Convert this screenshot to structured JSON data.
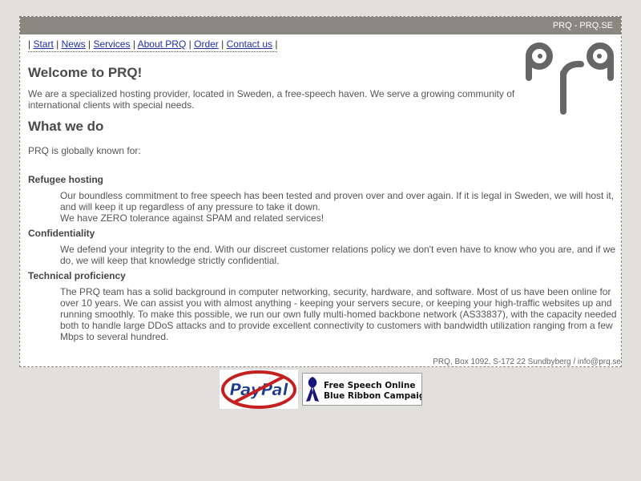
{
  "header": {
    "brand": "PRQ - PRQ.SE"
  },
  "nav": {
    "items": [
      "Start",
      "News",
      "Services",
      "About PRQ",
      "Order",
      "Contact us"
    ],
    "separator": "|"
  },
  "logo": {
    "text": "prq",
    "color": "#666666"
  },
  "main": {
    "welcome_title": "Welcome to PRQ!",
    "welcome_text": "We are a specialized hosting provider, located in Sweden, a free-speech haven. We serve a growing community of international clients with special needs.",
    "what_title": "What we do",
    "known_for": "PRQ is globally known for:",
    "sections": [
      {
        "term": "Refugee hosting",
        "desc1": "Our boundless commitment to free speech has been tested and proven over and over again. If it is legal in Sweden, we will host it, and will keep it up regardless of any pressure to take it down.",
        "desc2": "We have ZERO tolerance against SPAM and related services!"
      },
      {
        "term": "Confidentiality",
        "desc1": "We defend your integrity to the end. With our discreet customer relations policy we don't even have to know who you are, and if we do, we will keep that knowledge strictly confidential."
      },
      {
        "term": "Technical proficiency",
        "desc1": "The PRQ team has a solid background in computer networking, security, hardware, and software. Most of us have been online for over 10 years. We can assist you with almost anything - keeping your servers secure, or keeping your high-traffic websites up and running smoothly. To make this possible, we run our own fully multi-homed backbone network (AS33837), with the capacity needed both to handle large DDoS attacks and to provide excellent connectivity to customers with bandwidth utilization ranging from a few Mbps to several hundred."
      }
    ]
  },
  "footer": {
    "address": "PRQ, Box 1092, S-172 22 Sundbyberg / info@prq.se"
  },
  "badges": {
    "paypal_text": "PayPal",
    "ribbon_line1": "Free Speech Online",
    "ribbon_line2": "Blue Ribbon Campaign"
  },
  "colors": {
    "topbar": "#8a8781",
    "link": "#1f2ea8",
    "background": "#e2e0dc"
  }
}
